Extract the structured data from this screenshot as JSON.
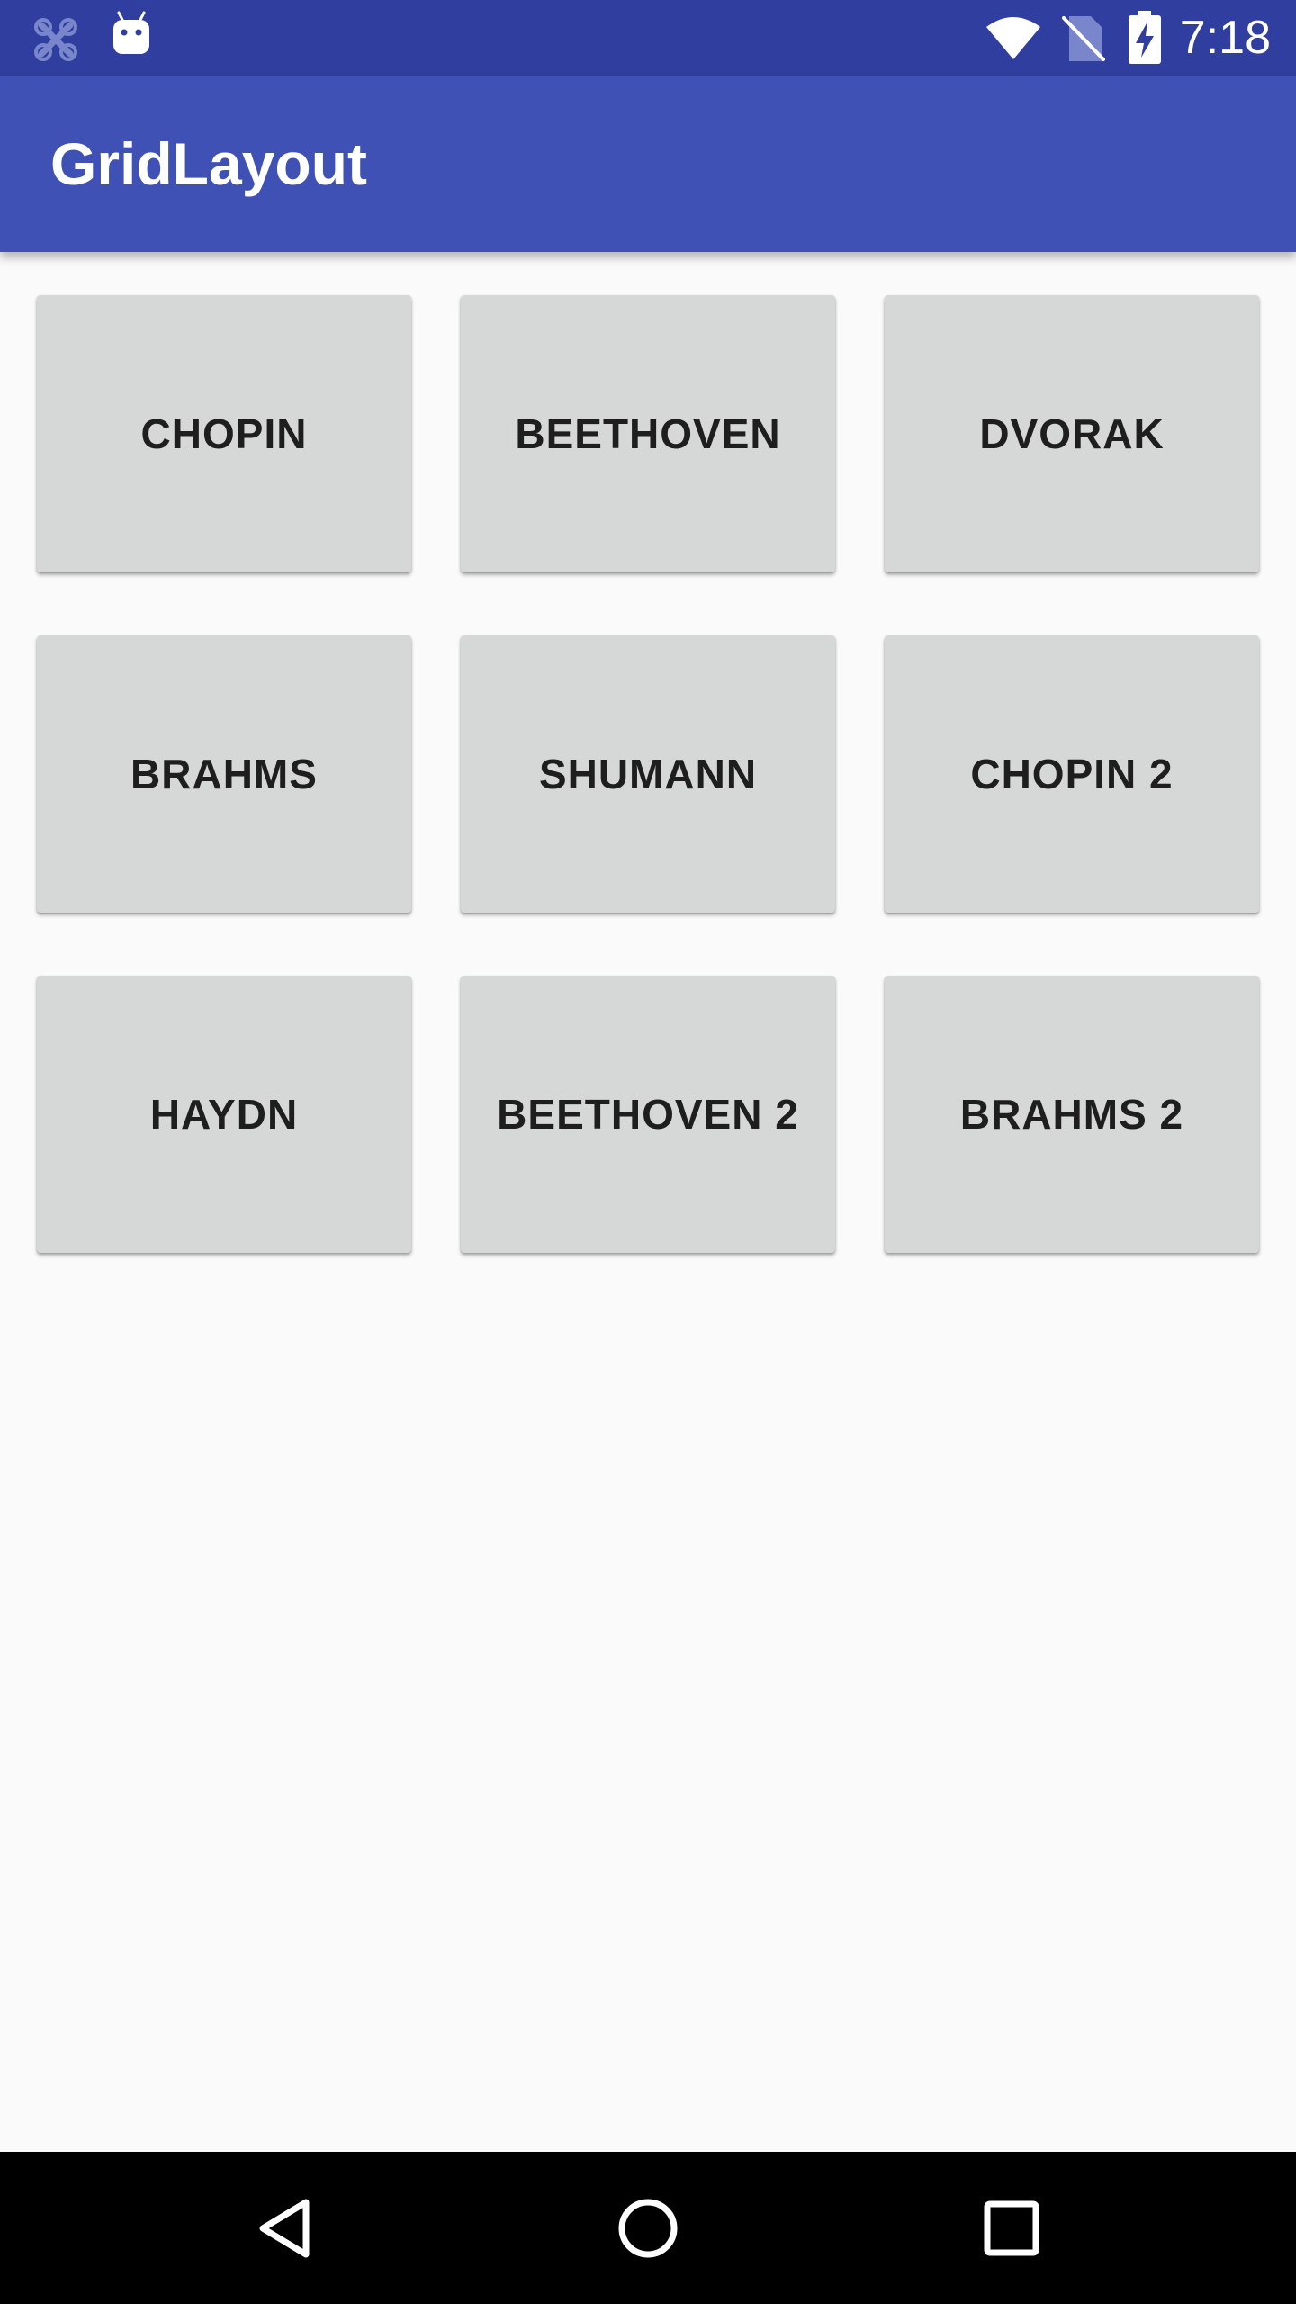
{
  "status_bar": {
    "time": "7:18",
    "left_icons": [
      "notification-x-icon",
      "android-robot-icon"
    ],
    "right_icons": [
      "wifi-icon",
      "no-sim-icon",
      "battery-charging-icon"
    ]
  },
  "app_bar": {
    "title": "GridLayout"
  },
  "grid": {
    "buttons": [
      {
        "label": "CHOPIN"
      },
      {
        "label": "BEETHOVEN"
      },
      {
        "label": "DVORAK"
      },
      {
        "label": "BRAHMS"
      },
      {
        "label": "SHUMANN"
      },
      {
        "label": "CHOPIN 2"
      },
      {
        "label": "HAYDN"
      },
      {
        "label": "BEETHOVEN 2"
      },
      {
        "label": "BRAHMS 2"
      }
    ]
  },
  "nav_bar": {
    "buttons": [
      "back-icon",
      "home-icon",
      "recents-icon"
    ]
  },
  "colors": {
    "primary": "#3f51b5",
    "primary_dark": "#303f9f",
    "button_bg": "#d6d7d7",
    "background": "#fafafa"
  }
}
